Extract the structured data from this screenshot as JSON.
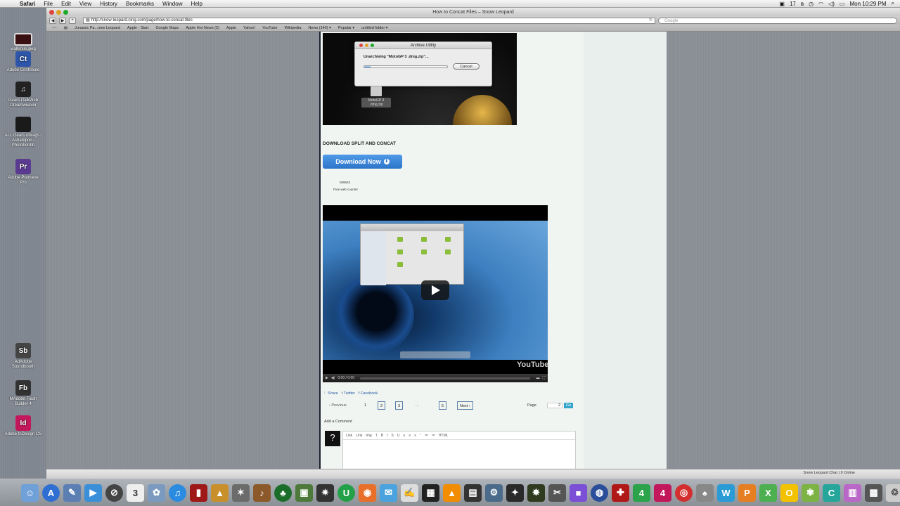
{
  "menubar": {
    "app": "Safari",
    "items": [
      "File",
      "Edit",
      "View",
      "History",
      "Bookmarks",
      "Window",
      "Help"
    ],
    "status_num": "17",
    "clock": "Mon 10:29 PM"
  },
  "desktop_icons": [
    {
      "label": "walkmiki.jpeg",
      "tile": "",
      "color": "#3a0f12"
    },
    {
      "label": "Adobe Contribute",
      "tile": "Ct",
      "color": "#2d55a8"
    },
    {
      "label": "Gears iTalkWeb Dreamweaver",
      "tile": "♫",
      "color": "#222"
    },
    {
      "label": "ALL Gears ofwags / Ashampoo / Photohonbb",
      "tile": "",
      "color": "#1a1a1a"
    },
    {
      "label": "Adobe Premiere Pro",
      "tile": "Pr",
      "color": "#5b3a91"
    },
    {
      "label": "AdAdobe Soundbooth",
      "tile": "Sb",
      "color": "#444"
    },
    {
      "label": "MAdobe Flash Builder 4",
      "tile": "Fb",
      "color": "#333"
    },
    {
      "label": "Adobe InDesign CS",
      "tile": "Id",
      "color": "#c2185b"
    }
  ],
  "browser": {
    "title": "How to Concat Files – Snow Leopard",
    "url": "http://snow-leopard.ning.com/page/how-to-concat-files",
    "search_placeholder": "Google",
    "bookmarks": [
      "Jurassic Pa...now Leopard",
      "Apple - Start",
      "Google Maps",
      "Apple Hot News (2)",
      "Apple",
      "Yahoo!",
      "YouTube",
      "Wikipedia",
      "News (140) ▾",
      "Popular ▾",
      "untitled folder ▾"
    ],
    "status_right": "Snow Leopard Chat | 9 Online"
  },
  "archive_dialog": {
    "title": "Archive Utility",
    "message": "Unarchiving \"MotoGP 3 .dmg.zip\"...",
    "cancel": "Cancel",
    "progress": 0.08,
    "file_label": "MotoGP 3 .dmg.zip"
  },
  "page": {
    "heading": "DOWNLOAD SPLIT AND CONCAT",
    "download_label": "Download Now",
    "counter": "009633",
    "counter_label": "Free web counter",
    "video": {
      "time": "0:00 / 0:00",
      "logo": "YouTube"
    },
    "share": [
      "Share",
      "Twitter",
      "Facebook"
    ],
    "pagination": {
      "previous": "‹ Previous",
      "pages": [
        "1",
        "2",
        "3"
      ],
      "ellipsis": "...",
      "last": "5",
      "next": "Next ›",
      "page_label": "Page",
      "page_value": "2",
      "go": "Go"
    },
    "add_comment": "Add a Comment",
    "editor_tools": [
      "Link",
      "Link",
      "Img",
      "T",
      "B",
      "I",
      "S",
      "U",
      "≡",
      "≡",
      "≡",
      "“",
      "≔",
      "≔",
      "HTML"
    ]
  }
}
